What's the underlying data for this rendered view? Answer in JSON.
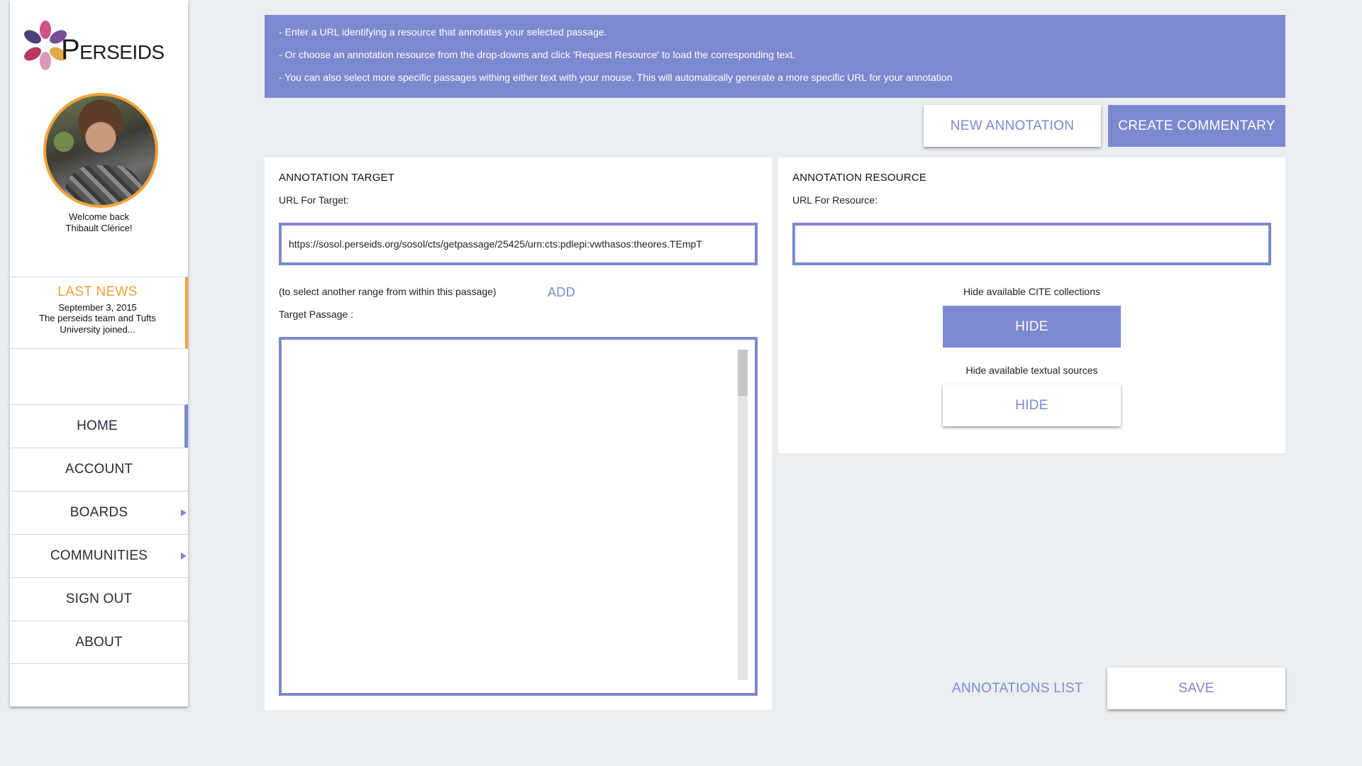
{
  "brand": {
    "name": "Perseids"
  },
  "user": {
    "welcome_line": "Welcome back",
    "name": "Thibault Clérice!"
  },
  "news": {
    "title": "LAST NEWS",
    "date": "September 3, 2015",
    "text": "The perseids team and Tufts University joined..."
  },
  "nav": {
    "items": [
      {
        "label": "HOME",
        "active": true,
        "has_submenu": false
      },
      {
        "label": "ACCOUNT",
        "active": false,
        "has_submenu": false
      },
      {
        "label": "BOARDS",
        "active": false,
        "has_submenu": true
      },
      {
        "label": "COMMUNITIES",
        "active": false,
        "has_submenu": true
      },
      {
        "label": "SIGN OUT",
        "active": false,
        "has_submenu": false
      },
      {
        "label": "ABOUT",
        "active": false,
        "has_submenu": false
      }
    ]
  },
  "banner": {
    "lines": [
      "- Enter a URL identifying a resource that annotates your selected passage.",
      "- Or choose an annotation resource from the drop-downs and click 'Request Resource' to load the corresponding text.",
      "- You can also select more specific passages withing either text with your mouse. This will automatically generate a more specific URL for your annotation"
    ]
  },
  "toolbar": {
    "new_annotation": "NEW ANNOTATION",
    "create_commentary": "CREATE COMMENTARY"
  },
  "target": {
    "title": "ANNOTATION TARGET",
    "url_label": "URL For Target:",
    "url_value": "https://sosol.perseids.org/sosol/cts/getpassage/25425/urn:cts:pdlepi:vwthasos:theores.TEmpT",
    "helper": "(to select another range from within this passage)",
    "add_label": "ADD",
    "passage_label": "Target Passage :",
    "passage_text": ""
  },
  "resource": {
    "title": "ANNOTATION RESOURCE",
    "url_label": "URL For Resource:",
    "url_value": "",
    "cite_label": "Hide available CITE collections",
    "cite_button": "HIDE",
    "text_label": "Hide available textual sources",
    "text_button": "HIDE"
  },
  "actions": {
    "annotations_list": "ANNOTATIONS LIST",
    "save": "SAVE"
  },
  "colors": {
    "accent": "#7d89cf",
    "news": "#f1a33b",
    "background": "#ebeef1"
  }
}
